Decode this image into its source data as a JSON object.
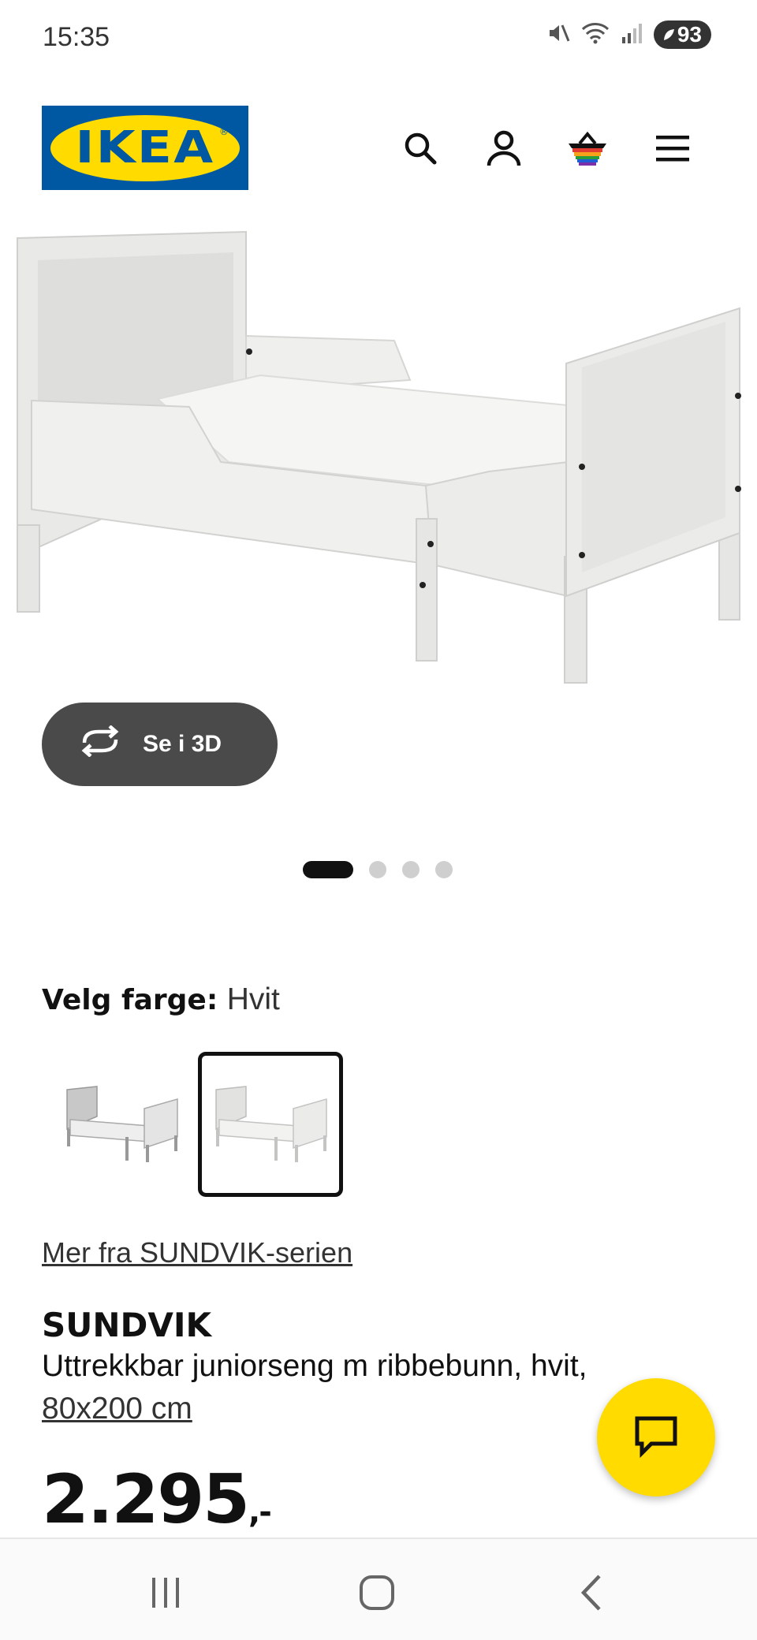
{
  "status_bar": {
    "time": "15:35",
    "battery": "93",
    "icons": [
      "mute-icon",
      "wifi-icon",
      "signal-icon",
      "battery-icon"
    ]
  },
  "header": {
    "logo_text": "IKEA",
    "icons": [
      "search-icon",
      "profile-icon",
      "basket-icon",
      "menu-icon"
    ]
  },
  "gallery": {
    "view_3d_label": "Se i 3D",
    "slide_count": 4,
    "active_slide": 1
  },
  "color_selector": {
    "label": "Velg farge:",
    "selected_value": "Hvit",
    "options": [
      "grey-white-variant",
      "white-variant"
    ],
    "selected_index": 1
  },
  "series_link": "Mer fra SUNDVIK-serien",
  "product": {
    "name": "SUNDVIK",
    "description": "Uttrekkbar juniorseng m ribbebunn, hvit,",
    "measurement": "80x200 cm",
    "price": "2.295",
    "price_suffix": ",-"
  },
  "colors": {
    "ikea_blue": "#0058a3",
    "ikea_yellow": "#ffdb00",
    "button_dark": "#4a4a4a"
  }
}
